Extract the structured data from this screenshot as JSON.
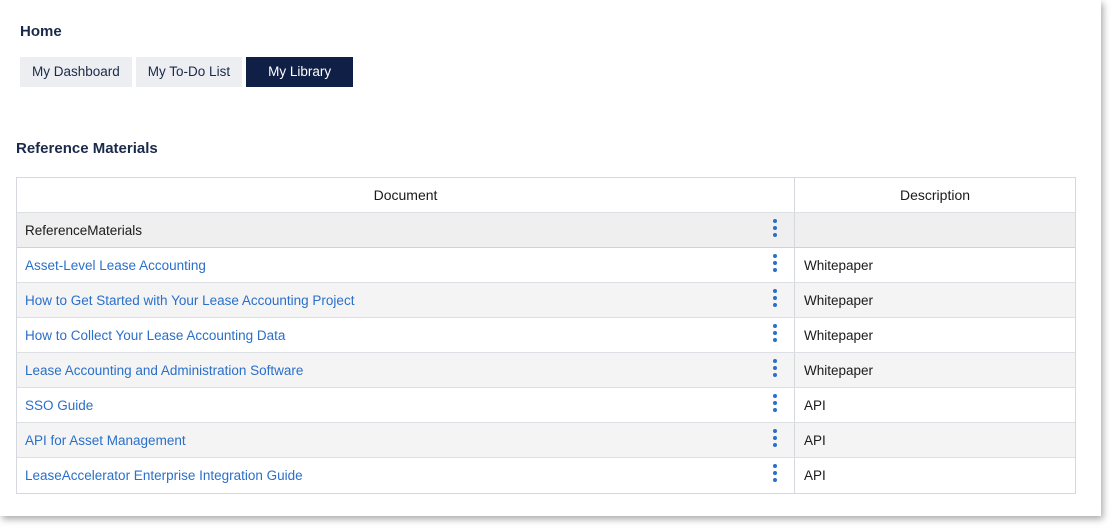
{
  "header": {
    "title": "Home"
  },
  "tabs": [
    {
      "label": "My Dashboard",
      "active": false
    },
    {
      "label": "My To-Do List",
      "active": false
    },
    {
      "label": "My Library",
      "active": true
    }
  ],
  "section": {
    "title": "Reference Materials"
  },
  "table": {
    "columns": {
      "document": "Document",
      "description": "Description"
    },
    "group": {
      "label": "ReferenceMaterials",
      "menu_icon": "kebab-menu-icon"
    },
    "rows": [
      {
        "document": "Asset-Level Lease Accounting",
        "description": "Whitepaper"
      },
      {
        "document": "How to Get Started with Your Lease Accounting Project",
        "description": "Whitepaper"
      },
      {
        "document": "How to Collect Your Lease Accounting Data",
        "description": "Whitepaper"
      },
      {
        "document": "Lease Accounting and Administration Software",
        "description": "Whitepaper"
      },
      {
        "document": "SSO Guide",
        "description": "API"
      },
      {
        "document": "API for Asset Management",
        "description": "API"
      },
      {
        "document": "LeaseAccelerator Enterprise Integration Guide",
        "description": "API"
      }
    ]
  },
  "colors": {
    "active_tab": "#0f1f45",
    "link": "#2a6fc9",
    "heading": "#1b2a4a"
  }
}
